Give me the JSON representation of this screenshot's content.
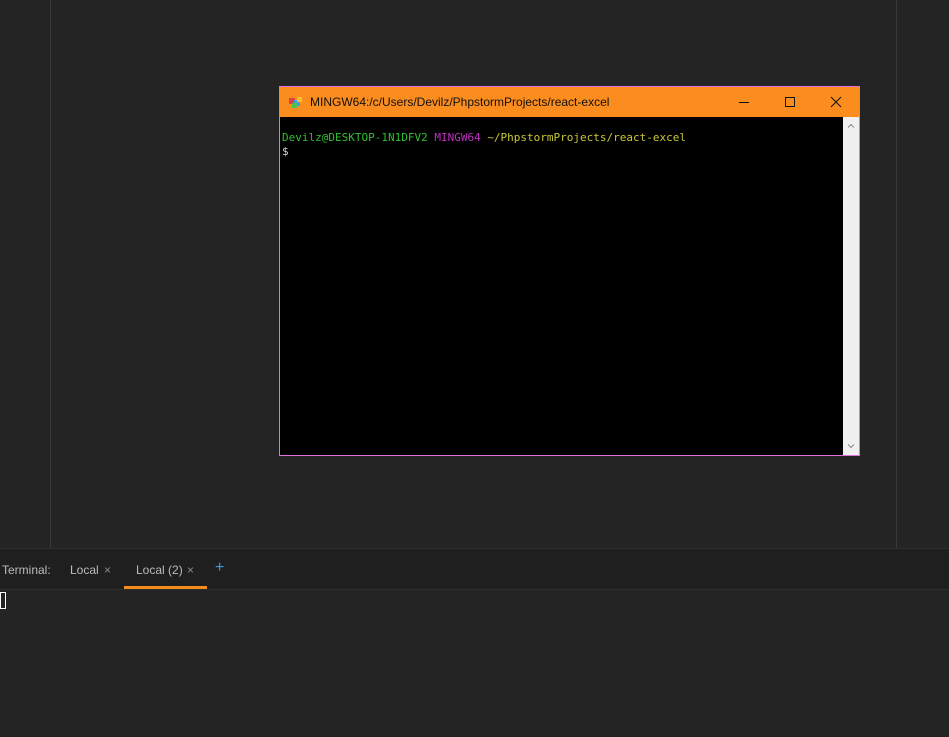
{
  "mintty": {
    "title": "MINGW64:/c/Users/Devilz/PhpstormProjects/react-excel",
    "prompt": {
      "user_host": "Devilz@DESKTOP-1N1DFV2",
      "system": "MINGW64",
      "path": "~/PhpstormProjects/react-excel",
      "symbol": "$"
    },
    "colors": {
      "titlebar": "#fb8c1e",
      "border": "#e070e0",
      "user_host": "#2fc02f",
      "system": "#c030c0",
      "path": "#c8c830"
    },
    "icons": {
      "app": "mintty-app-icon",
      "minimize": "minimize-icon",
      "maximize": "maximize-icon",
      "close": "close-icon",
      "scroll_up": "chevron-up-icon",
      "scroll_down": "chevron-down-icon"
    }
  },
  "terminal_tool": {
    "label": "Terminal:",
    "tabs": [
      {
        "label": "Local",
        "close": "×",
        "active": false
      },
      {
        "label": "Local (2)",
        "close": "×",
        "active": true
      }
    ],
    "add_tab": "+",
    "colors": {
      "active_underline": "#f28c1a",
      "add_button": "#3c9bd6"
    }
  }
}
